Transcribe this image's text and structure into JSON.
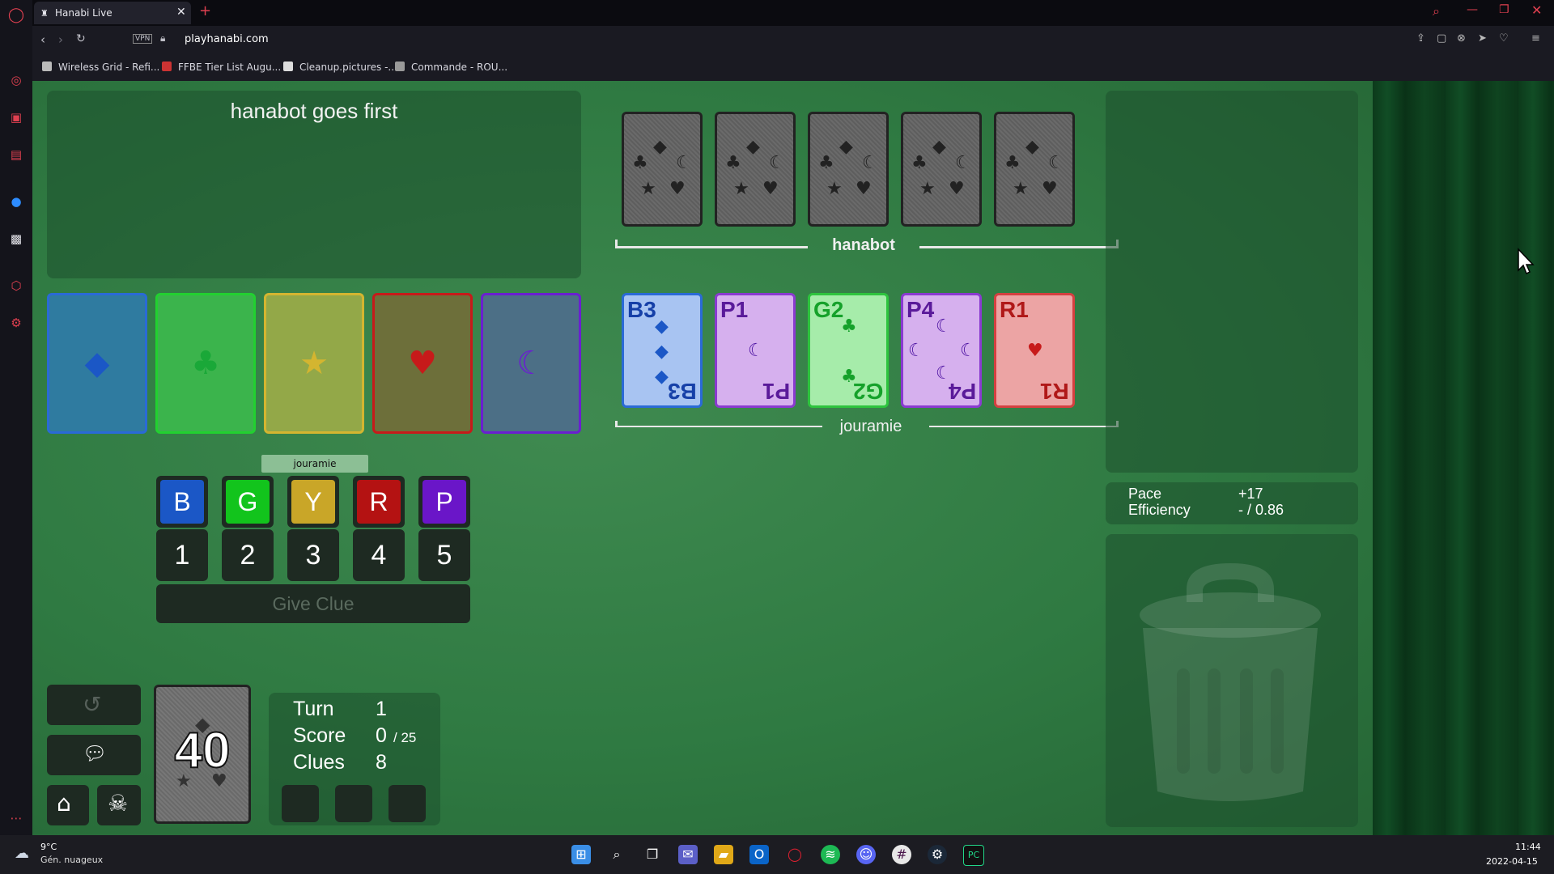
{
  "browser": {
    "tab_title": "Hanabi Live",
    "url": "playhanabi.com",
    "vpn_label": "VPN",
    "bookmarks": [
      "Wireless Grid - Refi...",
      "FFBE Tier List Augu...",
      "Cleanup.pictures -...",
      "Commande - ROU..."
    ]
  },
  "game": {
    "log_message": "hanabot goes first",
    "players": {
      "top": {
        "name": "hanabot",
        "card_count": 5
      },
      "bottom": {
        "name": "jouramie"
      }
    },
    "my_hand": [
      {
        "rank": "B3",
        "suit": "blue",
        "symbol": "◆",
        "rank_num": 3
      },
      {
        "rank": "P1",
        "suit": "purple",
        "symbol": "☾",
        "rank_num": 1
      },
      {
        "rank": "G2",
        "suit": "green",
        "symbol": "♣",
        "rank_num": 2
      },
      {
        "rank": "P4",
        "suit": "purple",
        "symbol": "☾",
        "rank_num": 4
      },
      {
        "rank": "R1",
        "suit": "red",
        "symbol": "♥",
        "rank_num": 1
      }
    ],
    "play_stacks": [
      {
        "suit": "blue",
        "symbol": "◆",
        "color": "#1b57c6"
      },
      {
        "suit": "green",
        "symbol": "♣",
        "color": "#1aa838"
      },
      {
        "suit": "yellow",
        "symbol": "★",
        "color": "#d4b530"
      },
      {
        "suit": "red",
        "symbol": "♥",
        "color": "#c71a1a"
      },
      {
        "suit": "purple",
        "symbol": "☾",
        "color": "#6a1fd0"
      }
    ],
    "clue_target": "jouramie",
    "color_buttons": [
      {
        "label": "B",
        "color": "#1b57c6"
      },
      {
        "label": "G",
        "color": "#12c41c"
      },
      {
        "label": "Y",
        "color": "#c9a628"
      },
      {
        "label": "R",
        "color": "#b41212"
      },
      {
        "label": "P",
        "color": "#6a16c8"
      }
    ],
    "number_buttons": [
      "1",
      "2",
      "3",
      "4",
      "5"
    ],
    "give_clue_label": "Give Clue",
    "deck_count": "40",
    "stats": {
      "turn_label": "Turn",
      "turn_value": "1",
      "score_label": "Score",
      "score_value": "0",
      "score_max": "/ 25",
      "clues_label": "Clues",
      "clues_value": "8"
    },
    "pace_label": "Pace",
    "pace_value": "+17",
    "efficiency_label": "Efficiency",
    "efficiency_value": "- / 0.86"
  },
  "taskbar": {
    "weather_temp": "9°C",
    "weather_desc": "Gén. nuageux",
    "time": "11:44",
    "date": "2022-04-15"
  }
}
